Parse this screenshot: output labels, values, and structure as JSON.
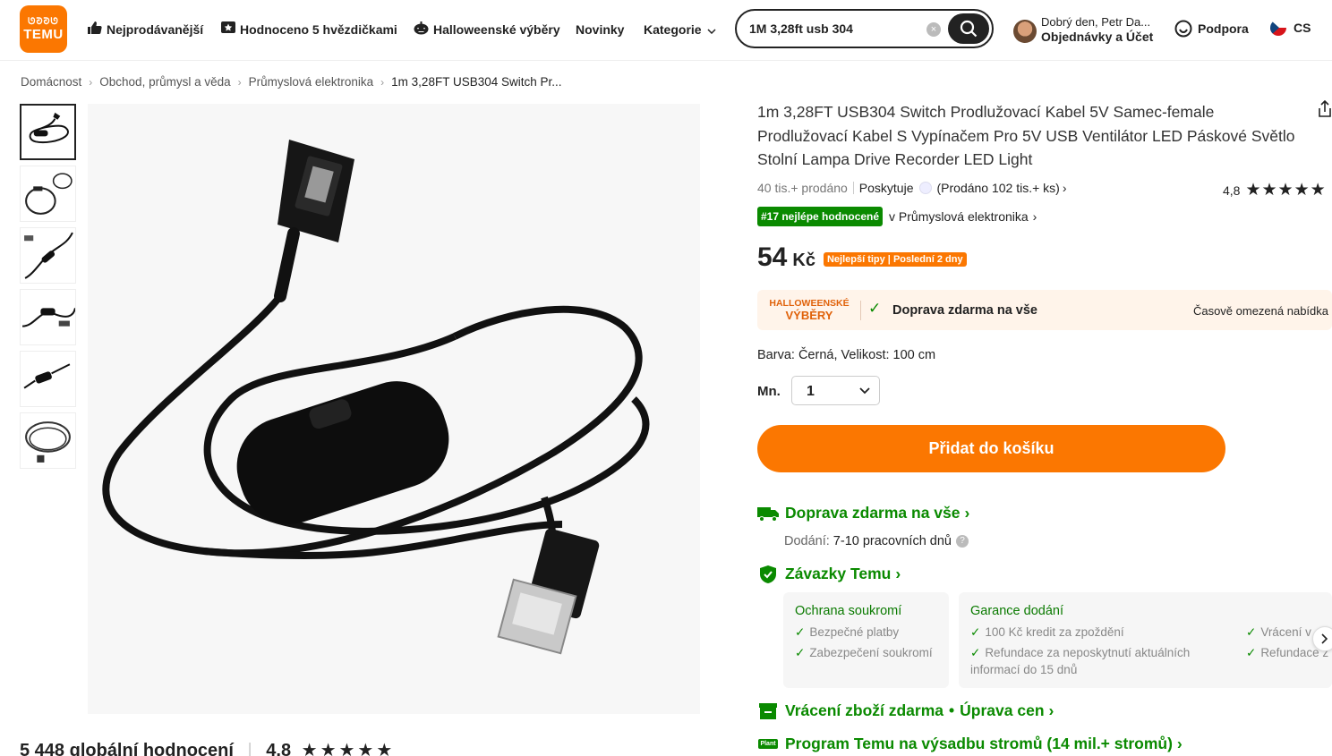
{
  "header": {
    "logo_line1": "ᘎᘑᘑᘎ",
    "logo_line2": "TEMU",
    "nav": [
      {
        "label": "Nejprodávanější",
        "icon": "thumbs-up-icon"
      },
      {
        "label": "Hodnoceno 5 hvězdičkami",
        "icon": "star-badge-icon"
      },
      {
        "label": "Halloweenské výběry",
        "icon": "pumpkin-icon"
      },
      {
        "label": "Novinky"
      },
      {
        "label": "Kategorie",
        "icon": "chevron-down-icon"
      }
    ],
    "search_value": "1M 3,28ft usb 304",
    "greeting": "Dobrý den, Petr Da...",
    "account": "Objednávky a Účet",
    "support": "Podpora",
    "language": "CS"
  },
  "breadcrumb": [
    "Domácnost",
    "Obchod, průmysl a věda",
    "Průmyslová elektronika",
    "1m 3,28FT USB304 Switch Pr..."
  ],
  "product": {
    "title": "1m 3,28FT USB304 Switch Prodlužovací Kabel 5V Samec-female Prodlužovací Kabel S Vypínačem Pro 5V USB Ventilátor LED Páskové Světlo Stolní Lampa Drive Recorder LED Light",
    "sold": "40 tis.+ prodáno",
    "provider": "Poskytuje",
    "provider_sold": "(Prodáno 102 tis.+ ks)",
    "rating": "4,8",
    "stars": 4.8,
    "rank_badge": "#17 nejlépe hodnocené",
    "rank_category": "v Průmyslová elektronika",
    "price": "54",
    "currency": "Kč",
    "price_tag": "Nejlepší tipy | Poslední 2 dny",
    "promo_line1": "HALLOWEENSKÉ",
    "promo_line2": "VÝBĚRY",
    "promo_shipping": "Doprava zdarma na vše",
    "promo_limited": "Časově omezená nabídka",
    "variant_label": "Barva:",
    "variant_value": "Černá, Velikost: 100 cm",
    "qty_label": "Mn.",
    "qty_value": "1",
    "add_to_cart": "Přidat do košíku"
  },
  "shipping": {
    "free": "Doprava zdarma na vše",
    "delivery_label": "Dodání:",
    "delivery_value": "7-10 pracovních dnů"
  },
  "commitments": {
    "title": "Závazky Temu",
    "privacy_title": "Ochrana soukromí",
    "privacy_items": [
      "Bezpečné platby",
      "Zabezpečení soukromí"
    ],
    "delivery_title": "Garance dodání",
    "delivery_items": [
      "100 Kč kredit za zpoždění",
      "Refundace za neposkytnutí aktuálních informací do 15 dnů"
    ],
    "delivery_items_right": [
      "Vrácení v",
      "Refundace z"
    ]
  },
  "returns": {
    "label1": "Vrácení zboží zdarma",
    "dot": "•",
    "label2": "Úprava cen"
  },
  "trees": {
    "icon_text": "Plant",
    "label": "Program Temu na výsadbu stromů (14 mil.+ stromů)"
  },
  "reviews": {
    "total": "5 448 globální hodnocení",
    "rating": "4,8"
  },
  "colors": {
    "accent": "#fb7701",
    "green": "#0a8a00"
  }
}
